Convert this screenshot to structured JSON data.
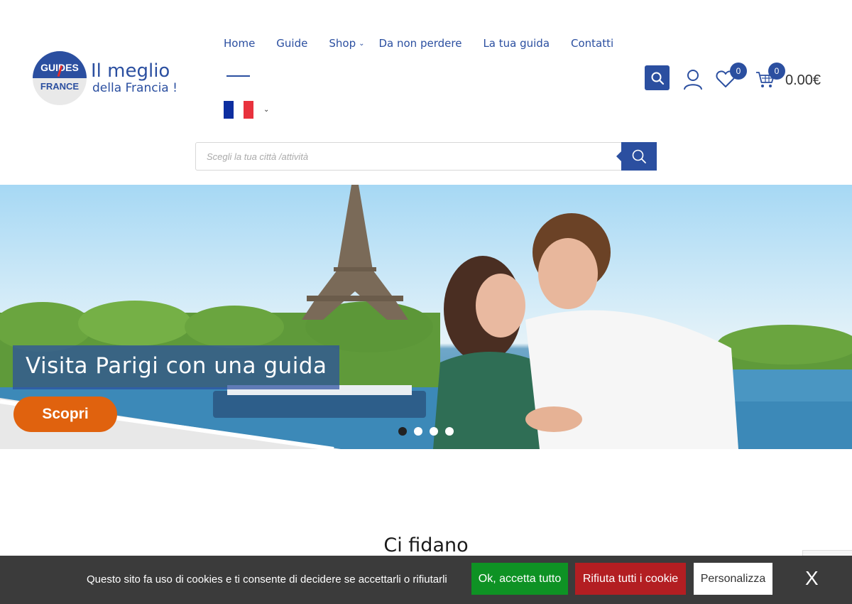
{
  "brand": {
    "logo_top": "GUIDES",
    "logo_bottom": "FRANCE",
    "title": "Il meglio",
    "subtitle": "della Francia !"
  },
  "nav": {
    "items": [
      {
        "label": "Home"
      },
      {
        "label": "Guide"
      },
      {
        "label": "Shop",
        "has_submenu": true
      },
      {
        "label": "Da non perdere"
      },
      {
        "label": "La tua guida"
      },
      {
        "label": "Contatti"
      }
    ],
    "active": "Home",
    "language": "french-flag-icon"
  },
  "header_icons": {
    "wishlist_count": "0",
    "cart_count": "0",
    "cart_total": "0.00€"
  },
  "search": {
    "placeholder": "Scegli la tua città /attività"
  },
  "hero": {
    "title": "Visita Parigi con una guida",
    "button": "Scopri",
    "slides": 4,
    "active_slide": 1
  },
  "section": {
    "title": "Ci fidano"
  },
  "cookie": {
    "text": "Questo sito fa uso di cookies e ti consente di decidere se accettarli o rifiutarli",
    "accept": "Ok, accetta tutto",
    "reject": "Rifiuta tutti i cookie",
    "customize": "Personalizza",
    "close": "X"
  },
  "colors": {
    "brand_blue": "#2b4fa0",
    "cta_orange": "#e0620e",
    "accept_green": "#0e9224",
    "reject_red": "#b31e22",
    "cookie_bg": "#3b3b3b"
  }
}
